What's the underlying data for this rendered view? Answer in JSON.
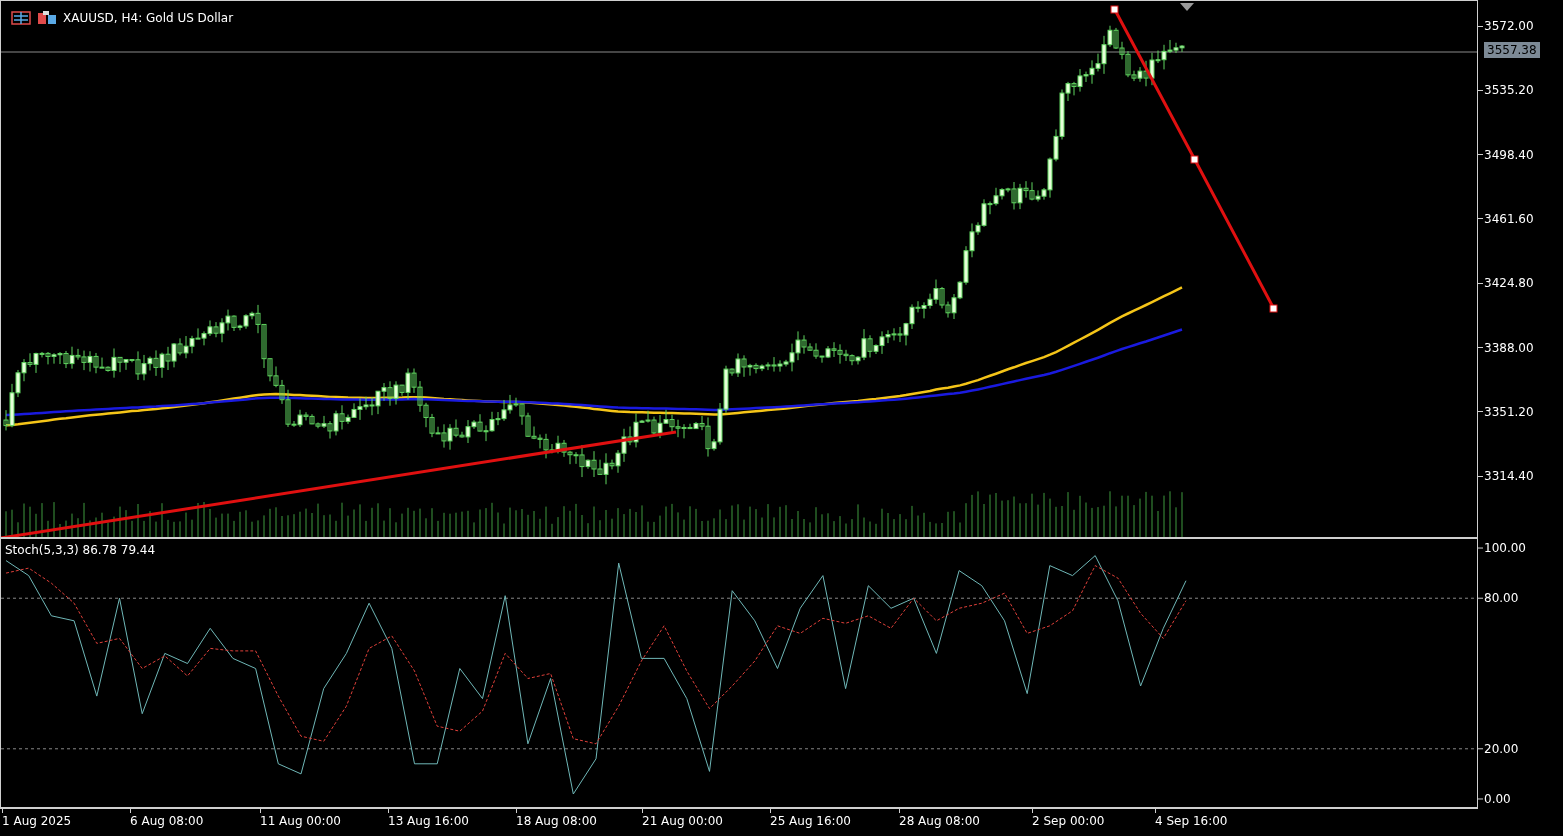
{
  "window": {
    "title": "XAUUSD, H4:  Gold US Dollar"
  },
  "price_axis": {
    "labels": [
      "3572.00",
      "3535.20",
      "3498.40",
      "3461.60",
      "3424.80",
      "3388.00",
      "3351.20",
      "3314.40"
    ],
    "current_price": "3557.38"
  },
  "stochastic": {
    "legend": "Stoch(5,3,3) 86.78 79.44",
    "chart_data": {
      "type": "line",
      "ylim": [
        -3.2,
        103.6
      ],
      "yticks": [
        {
          "value": 100,
          "label": "100.00"
        },
        {
          "value": 80,
          "label": "80.00"
        },
        {
          "value": 20,
          "label": "20.00"
        },
        {
          "value": 0,
          "label": "0.00"
        }
      ],
      "series": [
        {
          "color": "#6fb7b7",
          "line_style": "solid",
          "values": [
            95,
            89,
            73,
            71,
            41,
            80,
            34,
            58,
            54,
            68,
            56,
            52,
            14,
            10,
            44,
            58,
            78,
            60,
            14,
            14,
            52,
            40,
            81,
            22,
            48,
            2,
            16,
            94,
            56,
            56,
            40,
            11,
            83,
            71,
            52,
            76,
            89,
            44,
            85,
            76,
            80,
            58,
            91,
            85,
            71,
            42,
            93,
            89,
            97,
            79,
            45,
            68,
            87
          ]
        },
        {
          "color": "#e0403a",
          "line_style": "dashed",
          "values": [
            90,
            92,
            86,
            78,
            62,
            64,
            52,
            57,
            49,
            60,
            59,
            59,
            41,
            25,
            23,
            37,
            60,
            65,
            51,
            29,
            27,
            35,
            58,
            48,
            50,
            24,
            22,
            37,
            55,
            69,
            51,
            36,
            45,
            55,
            69,
            66,
            72,
            70,
            73,
            68,
            80,
            71,
            76,
            78,
            82,
            66,
            69,
            75,
            93,
            88,
            74,
            64,
            79
          ]
        }
      ]
    }
  },
  "time_axis": {
    "labels": [
      "1 Aug 2025",
      "6 Aug 08:00",
      "11 Aug 00:00",
      "13 Aug 16:00",
      "18 Aug 08:00",
      "21 Aug 00:00",
      "25 Aug 16:00",
      "28 Aug 08:00",
      "2 Sep 00:00",
      "4 Sep 16:00"
    ]
  }
}
